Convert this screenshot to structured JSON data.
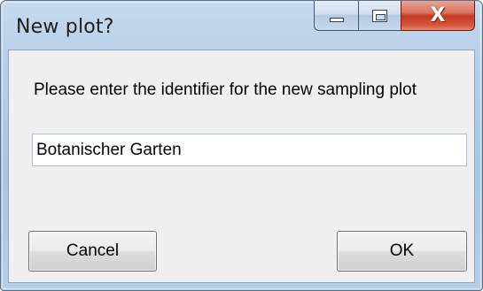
{
  "window": {
    "title": "New plot?",
    "controls": {
      "minimize": "minimize-icon",
      "maximize": "maximize-icon",
      "close": "close-icon",
      "close_glyph": "X"
    }
  },
  "dialog": {
    "prompt": "Please enter the identifier for the new sampling plot",
    "input_value": "Botanischer Garten",
    "cancel_label": "Cancel",
    "ok_label": "OK"
  },
  "colors": {
    "frame": "#b7d0e9",
    "close_button": "#c2391f",
    "client_background": "#f0f0f0"
  }
}
